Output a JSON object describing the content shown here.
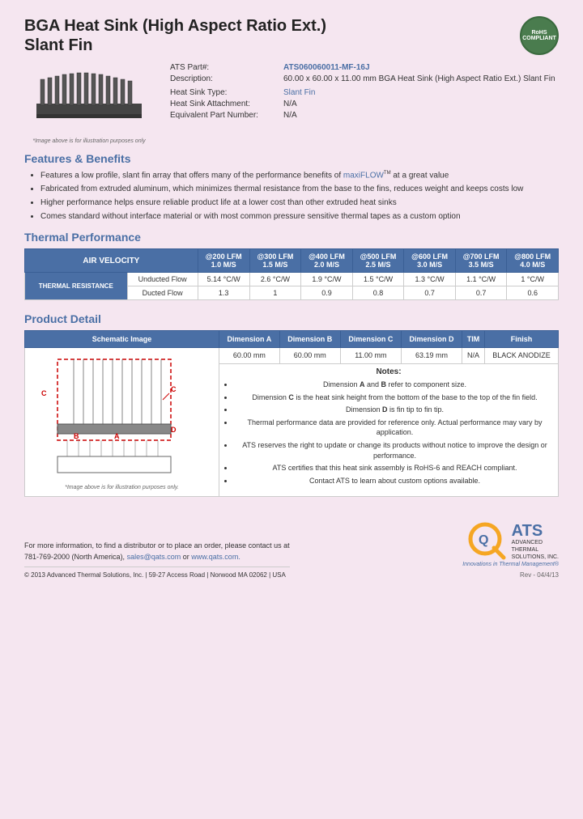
{
  "header": {
    "title_line1": "BGA Heat Sink (High Aspect Ratio Ext.)",
    "title_line2": "Slant Fin",
    "rohs_line1": "RoHS",
    "rohs_line2": "COMPLIANT"
  },
  "product_info": {
    "part_label": "ATS Part#:",
    "part_value": "ATS060060011-MF-16J",
    "description_label": "Description:",
    "description_value": "60.00 x 60.00 x 11.00 mm BGA Heat Sink (High Aspect Ratio Ext.) Slant Fin",
    "heat_sink_type_label": "Heat Sink Type:",
    "heat_sink_type_value": "Slant Fin",
    "attachment_label": "Heat Sink Attachment:",
    "attachment_value": "N/A",
    "equiv_part_label": "Equivalent Part Number:",
    "equiv_part_value": "N/A"
  },
  "image_caption": "*Image above is for illustration purposes only",
  "features": {
    "section_title": "Features & Benefits",
    "items": [
      "Features a low profile, slant fin array that offers many of the performance benefits of maxiFLOW™ at a great value",
      "Fabricated from extruded aluminum, which minimizes thermal resistance from the base to the fins, reduces weight and keeps costs low",
      "Higher performance helps ensure reliable product life at a lower cost than other extruded heat sinks",
      "Comes standard without interface material or with most common pressure sensitive thermal tapes as a custom option"
    ]
  },
  "thermal_performance": {
    "section_title": "Thermal Performance",
    "air_velocity_label": "AIR VELOCITY",
    "columns": [
      {
        "top": "@200 LFM",
        "bottom": "1.0 M/S"
      },
      {
        "top": "@300 LFM",
        "bottom": "1.5 M/S"
      },
      {
        "top": "@400 LFM",
        "bottom": "2.0 M/S"
      },
      {
        "top": "@500 LFM",
        "bottom": "2.5 M/S"
      },
      {
        "top": "@600 LFM",
        "bottom": "3.0 M/S"
      },
      {
        "top": "@700 LFM",
        "bottom": "3.5 M/S"
      },
      {
        "top": "@800 LFM",
        "bottom": "4.0 M/S"
      }
    ],
    "row_label": "THERMAL RESISTANCE",
    "subrows": [
      {
        "label": "Unducted Flow",
        "values": [
          "5.14 °C/W",
          "2.6 °C/W",
          "1.9 °C/W",
          "1.5 °C/W",
          "1.3 °C/W",
          "1.1 °C/W",
          "1 °C/W"
        ]
      },
      {
        "label": "Ducted Flow",
        "values": [
          "1.3",
          "1",
          "0.9",
          "0.8",
          "0.7",
          "0.7",
          "0.6"
        ]
      }
    ]
  },
  "product_detail": {
    "section_title": "Product Detail",
    "headers": [
      "Schematic Image",
      "Dimension A",
      "Dimension B",
      "Dimension C",
      "Dimension D",
      "TIM",
      "Finish"
    ],
    "values": [
      "60.00 mm",
      "60.00 mm",
      "11.00 mm",
      "63.19 mm",
      "N/A",
      "BLACK ANODIZE"
    ],
    "schematic_caption": "*Image above is for illustration purposes only."
  },
  "notes": {
    "title": "Notes:",
    "items": [
      "Dimension A and B refer to component size.",
      "Dimension C is the heat sink height from the bottom of the base to the top of the fin field.",
      "Dimension D is fin tip to fin tip.",
      "Thermal performance data are provided for reference only. Actual performance may vary by application.",
      "ATS reserves the right to update or change its products without notice to improve the design or performance.",
      "ATS certifies that this heat sink assembly is RoHS-6 and REACH compliant.",
      "Contact ATS to learn about custom options available."
    ]
  },
  "footer": {
    "contact_text": "For more information, to find a distributor or to place an order, please contact us at",
    "phone": "781-769-2000 (North America),",
    "email": "sales@qats.com",
    "or_text": "or",
    "website": "www.qats.com.",
    "copyright": "© 2013 Advanced Thermal Solutions, Inc.  |  59-27 Access Road  |  Norwood MA  02062  |  USA",
    "ats_label": "ATS",
    "ats_sub1": "ADVANCED",
    "ats_sub2": "THERMAL",
    "ats_sub3": "SOLUTIONS, INC.",
    "ats_tagline": "Innovations in Thermal Management®",
    "page_number": "Rev - 04/4/13"
  }
}
